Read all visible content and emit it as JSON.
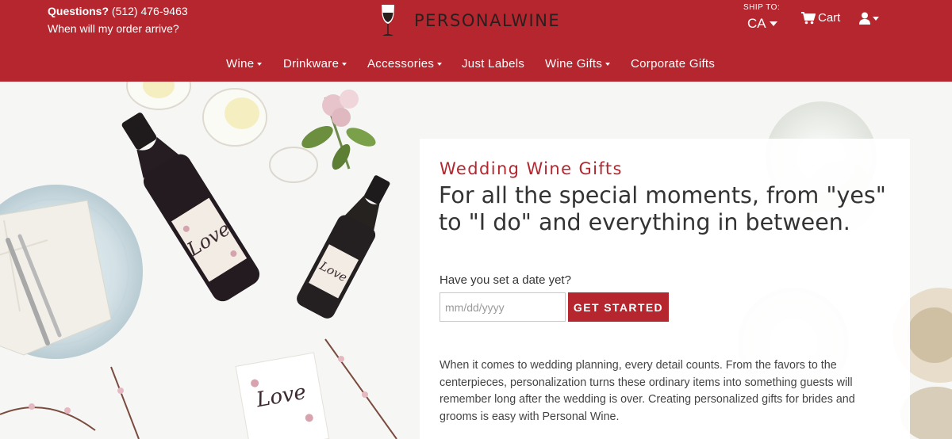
{
  "header": {
    "questions_label": "Questions?",
    "phone": "(512) 476-9463",
    "order_link": "When will my order arrive?",
    "logo_part1": "PERSONAL",
    "logo_part2": "WINE",
    "ship_to_label": "SHIP TO:",
    "ship_to_value": "CA",
    "cart_label": "Cart",
    "icons": [
      "wine-glass-logo-icon",
      "cart-icon",
      "user-icon"
    ]
  },
  "nav": {
    "items": [
      {
        "label": "Wine",
        "dropdown": true
      },
      {
        "label": "Drinkware",
        "dropdown": true
      },
      {
        "label": "Accessories",
        "dropdown": true
      },
      {
        "label": "Just Labels",
        "dropdown": false
      },
      {
        "label": "Wine Gifts",
        "dropdown": true
      },
      {
        "label": "Corporate Gifts",
        "dropdown": false
      }
    ]
  },
  "hero": {
    "eyebrow": "Wedding Wine Gifts",
    "headline": "For all the special moments, from \"yes\" to \"I do\" and everything in between.",
    "question": "Have you set a date yet?",
    "date_placeholder": "mm/dd/yyyy",
    "cta_label": "GET STARTED",
    "body": "When it comes to wedding planning, every detail counts. From the favors to the centerpieces, personalization turns these ordinary items into something guests will remember long after the wedding is over. Creating personalized gifts for brides and grooms is easy with Personal Wine.",
    "label_art_text": "Love"
  },
  "colors": {
    "brand_red": "#b5262e",
    "text_dark": "#333333",
    "header_text": "#ffffff"
  }
}
